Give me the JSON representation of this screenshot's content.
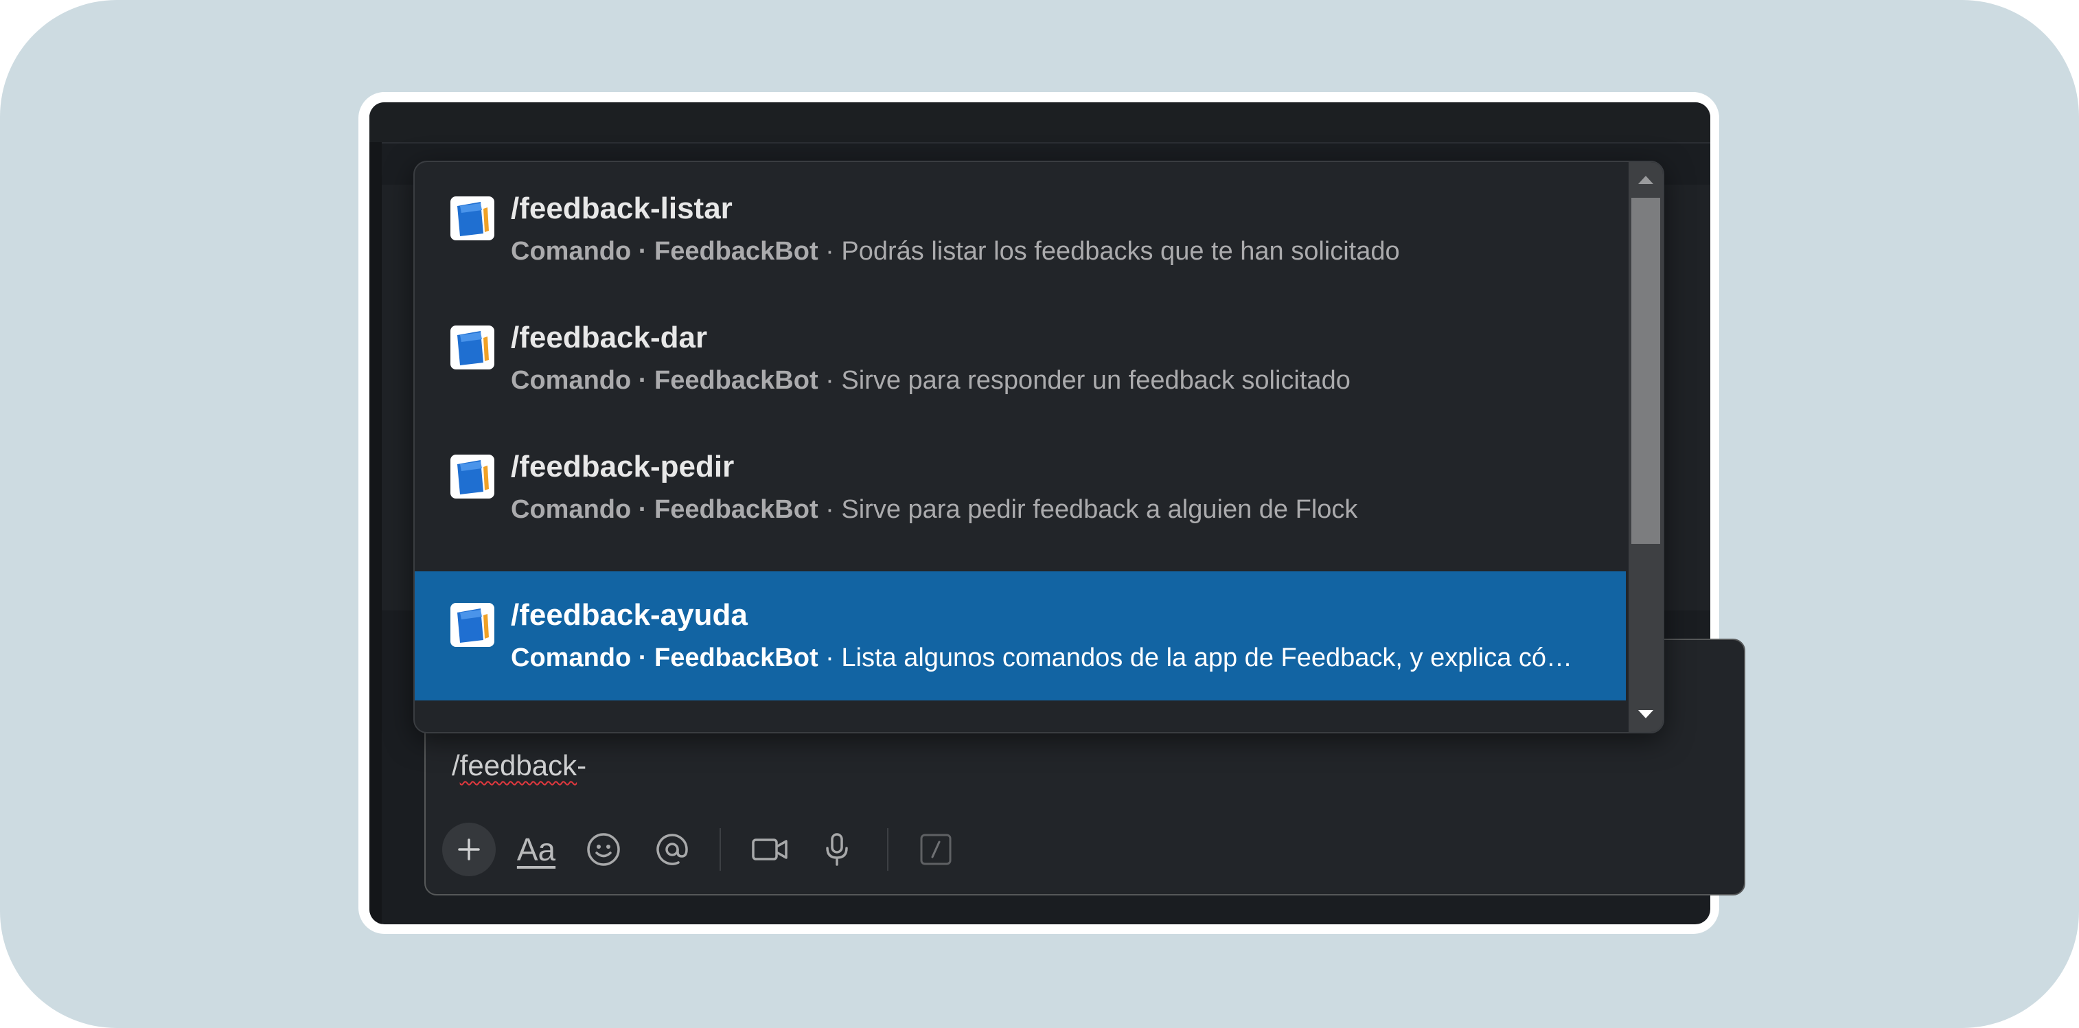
{
  "composer": {
    "prefix": "/",
    "squiggle_text": "feedback",
    "suffix": "-"
  },
  "autocomplete": {
    "items": [
      {
        "name": "/feedback-listar",
        "meta": "Comando · FeedbackBot",
        "sep": " · ",
        "description": "Podrás listar los feedbacks que te han solicitado",
        "icon": "notebook-icon"
      },
      {
        "name": "/feedback-dar",
        "meta": "Comando · FeedbackBot",
        "sep": " · ",
        "description": "Sirve para responder un feedback solicitado",
        "icon": "notebook-icon"
      },
      {
        "name": "/feedback-pedir",
        "meta": "Comando · FeedbackBot",
        "sep": " · ",
        "description": "Sirve para pedir feedback a alguien de Flock",
        "icon": "notebook-icon"
      },
      {
        "name": "/feedback-ayuda",
        "meta": "Comando · FeedbackBot",
        "sep": " · ",
        "description": "Lista algunos comandos de la app de Feedback, y explica có…",
        "icon": "notebook-icon"
      }
    ],
    "selected_index": 3
  },
  "toolbar": {
    "format_label": "Aa",
    "icons": [
      "plus-icon",
      "formatting-icon",
      "emoji-icon",
      "mention-icon",
      "video-icon",
      "microphone-icon",
      "slash-command-icon"
    ]
  },
  "colors": {
    "selection": "#1264a3",
    "background": "#cddbe1",
    "window": "#1a1d21"
  }
}
